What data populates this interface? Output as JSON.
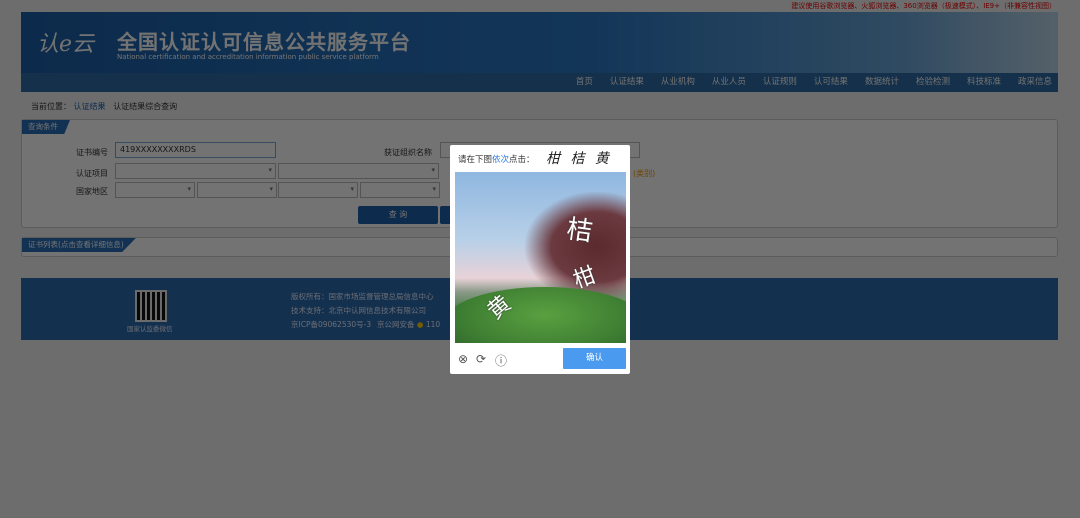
{
  "browser_tip": "建议使用谷歌浏览器、火狐浏览器、360浏览器（极速模式）、IE9+（非兼容性视图）",
  "header": {
    "logo": "认e云",
    "title": "全国认证认可信息公共服务平台",
    "subtitle": "National certification and accreditation information public service platform"
  },
  "nav": [
    "首页",
    "认证结果",
    "从业机构",
    "从业人员",
    "认证规则",
    "认可结果",
    "数据统计",
    "检验检测",
    "科技标准",
    "政采信息"
  ],
  "breadcrumb": {
    "label": "当前位置：",
    "items": [
      "认证结果",
      "认证结果综合查询"
    ]
  },
  "query": {
    "tab": "查询条件",
    "cert_no_label": "证书编号",
    "cert_no_value": "419XXXXXXXXRDS",
    "org_label": "获证组织名称",
    "project_label": "认证项目",
    "region_label": "国家地区",
    "hint": "(类别)",
    "search_button": "查 询"
  },
  "cert_list": {
    "tab": "证书列表(点击查看详细信息)"
  },
  "footer": {
    "qr_label": "国家认监委微信",
    "copyright": "版权所有：国家市场监督管理总局信息中心",
    "tech": "技术支持：北京中认网信息技术有限公司",
    "icp": "京ICP备09062530号-3",
    "police": "京公网安备",
    "police_no": "110"
  },
  "captcha": {
    "prompt_pre": "请在下图",
    "prompt_em": "依次",
    "prompt_post": "点击：",
    "targets": "柑 桔 黄",
    "image_chars": [
      "桔",
      "柑",
      "黄"
    ],
    "confirm": "确认"
  }
}
